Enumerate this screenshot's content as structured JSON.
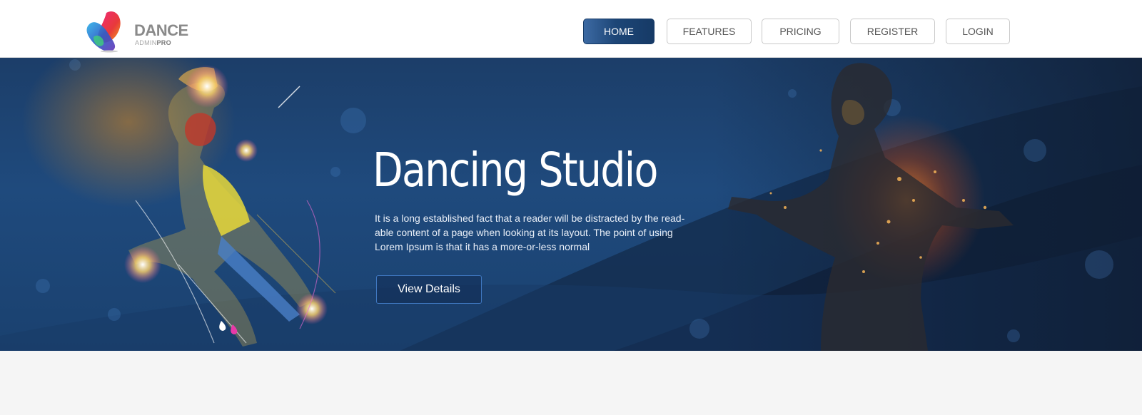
{
  "brand": {
    "name": "DANCE",
    "sub_light": "ADMIN",
    "sub_bold": "PRO"
  },
  "nav": {
    "items": [
      {
        "label": "HOME",
        "active": true
      },
      {
        "label": "FEATURES",
        "active": false
      },
      {
        "label": "PRICING",
        "active": false
      },
      {
        "label": "REGISTER",
        "active": false
      },
      {
        "label": "LOGIN",
        "active": false
      }
    ]
  },
  "hero": {
    "title": "Dancing Studio",
    "description": "It is a long established fact that a reader will be distracted by the read-able content of a page when looking at its layout. The point of using Lorem Ipsum is that it has a more-or-less normal",
    "button_label": "View Details"
  },
  "colors": {
    "accent": "#1d4677",
    "hero_bg": "#1f4a7d",
    "page_bg": "#f5f5f5"
  }
}
